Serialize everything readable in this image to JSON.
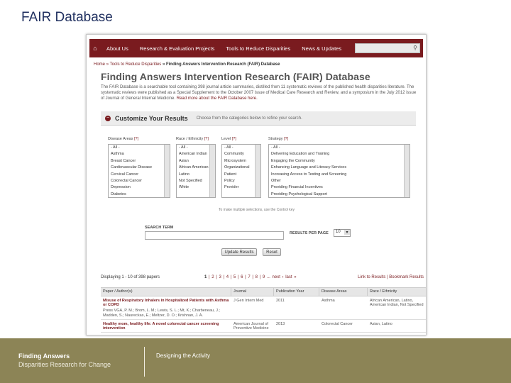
{
  "slide": {
    "title": "FAIR Database"
  },
  "nav": {
    "items": [
      "About Us",
      "Research & Evaluation Projects",
      "Tools to Reduce Disparities",
      "News & Updates"
    ]
  },
  "breadcrumb": {
    "home": "Home",
    "parent": "» Tools to Reduce Disparities",
    "current": "» Finding Answers Intervention Research (FAIR) Database"
  },
  "page": {
    "heading": "Finding Answers Intervention Research (FAIR) Database",
    "intro": "The FAIR Database is a searchable tool containing 398 journal article summaries, distilled from 11 systematic reviews of the published health disparities literature. The systematic reviews were published as a Special Supplement to the October 2007 issue of Medical Care Research and Review, and a symposium in the July 2012 issue of Journal of General Internal Medicine.",
    "intro_link": "Read more about the FAIR Database here."
  },
  "customize": {
    "title": "Customize Your Results",
    "subtitle": "Choose from the categories below to refine your search."
  },
  "filters": {
    "disease": {
      "label": "Disease Areas",
      "help": "[?]",
      "options": [
        "- All -",
        "Asthma",
        "Breast Cancer",
        "Cardiovascular Disease",
        "Cervical Cancer",
        "Colorectal Cancer",
        "Depression",
        "Diabetes"
      ]
    },
    "race": {
      "label": "Race / Ethnicity",
      "help": "[?]",
      "options": [
        "- All -",
        "American Indian",
        "Asian",
        "African American",
        "Latino",
        "Not Specified",
        "White"
      ]
    },
    "level": {
      "label": "Level",
      "help": "[?]",
      "options": [
        "- All -",
        "Community",
        "Microsystem",
        "Organizational",
        "Patient",
        "Policy",
        "Provider"
      ]
    },
    "strategy": {
      "label": "Strategy",
      "help": "[?]",
      "options": [
        "- All -",
        "Delivering Education and Training",
        "Engaging the Community",
        "Enhancing Language and Literacy Services",
        "Increasing Access to Testing and Screening",
        "Other",
        "Providing Financial Incentives",
        "Providing Psychological Support"
      ]
    },
    "note": "To make multiple selections, use the Control key"
  },
  "search": {
    "term_label": "SEARCH TERM",
    "term_value": "",
    "rpp_label": "RESULTS PER PAGE",
    "rpp_value": "10",
    "update_label": "Update Results",
    "reset_label": "Reset"
  },
  "results": {
    "displaying": "Displaying 1 - 10 of 398 papers",
    "current_page": "1",
    "pager_rest": "| 2 | 3 | 4 | 5 | 6 | 7 | 8 | 9 ... next › last »",
    "links": "Link to Results | Bookmark Results",
    "columns": [
      "Paper / Author(s)",
      "Journal",
      "Publication Year",
      "Disease Areas",
      "Race / Ethnicity"
    ],
    "rows": [
      {
        "title": "Misuse of Respiratory Inhalers in Hospitalized Patients with Asthma or COPD",
        "authors": "Press VGA, P. M.; Brom, L. M.; Lewis, S. L.; Mt, K.; Charbeneau, J.; Madden, S.; Naureckas, E.; Meltzer, D. O.; Krishnan, J. A.",
        "journal": "J Gen Intern Med",
        "year": "2011",
        "disease": "Asthma",
        "race": "African American, Latino, American Indian, Not Specified"
      },
      {
        "title": "Healthy mom, healthy life: A novel colorectal cancer screening intervention",
        "authors": "",
        "journal": "American Journal of Preventive Medicine",
        "year": "2013",
        "disease": "Colorectal Cancer",
        "race": "Asian, Latino"
      }
    ]
  },
  "footer": {
    "brand_line1": "Finding Answers",
    "brand_line2": "Disparities Research for Change",
    "section": "Designing the Activity"
  }
}
